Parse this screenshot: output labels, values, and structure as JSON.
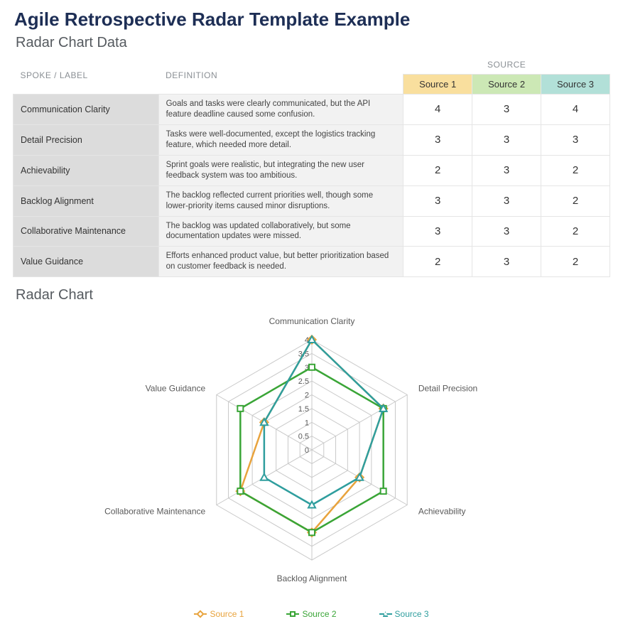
{
  "page_title": "Agile Retrospective Radar Template Example",
  "table_heading": "Radar Chart Data",
  "chart_heading": "Radar Chart",
  "headers": {
    "spoke": "SPOKE / LABEL",
    "definition": "DEFINITION",
    "source_group": "SOURCE",
    "sources": [
      "Source 1",
      "Source 2",
      "Source 3"
    ]
  },
  "rows": [
    {
      "spoke": "Communication Clarity",
      "definition": "Goals and tasks were clearly communicated, but the API feature deadline caused some confusion.",
      "values": [
        4,
        3,
        4
      ]
    },
    {
      "spoke": "Detail Precision",
      "definition": "Tasks were well-documented, except the logistics tracking feature, which needed more detail.",
      "values": [
        3,
        3,
        3
      ]
    },
    {
      "spoke": "Achievability",
      "definition": "Sprint goals were realistic, but integrating the new user feedback system was too ambitious.",
      "values": [
        2,
        3,
        2
      ]
    },
    {
      "spoke": "Backlog Alignment",
      "definition": "The backlog reflected current priorities well, though some lower-priority items caused minor disruptions.",
      "values": [
        3,
        3,
        2
      ]
    },
    {
      "spoke": "Collaborative Maintenance",
      "definition": "The backlog was updated collaboratively, but some documentation updates were missed.",
      "values": [
        3,
        3,
        2
      ]
    },
    {
      "spoke": "Value Guidance",
      "definition": "Efforts enhanced product value, but better prioritization based on customer feedback is needed.",
      "values": [
        2,
        3,
        2
      ]
    }
  ],
  "legend": [
    "Source 1",
    "Source 2",
    "Source 3"
  ],
  "series_colors": {
    "Source 1": "#e8a33d",
    "Source 2": "#3aa537",
    "Source 3": "#2f9e9e"
  },
  "chart_data": {
    "type": "radar",
    "title": "",
    "categories": [
      "Communication Clarity",
      "Detail Precision",
      "Achievability",
      "Backlog Alignment",
      "Collaborative Maintenance",
      "Value Guidance"
    ],
    "series": [
      {
        "name": "Source 1",
        "values": [
          4,
          3,
          2,
          3,
          3,
          2
        ]
      },
      {
        "name": "Source 2",
        "values": [
          3,
          3,
          3,
          3,
          3,
          3
        ]
      },
      {
        "name": "Source 3",
        "values": [
          4,
          3,
          2,
          2,
          2,
          2
        ]
      }
    ],
    "ticks": [
      0,
      0.5,
      1,
      1.5,
      2,
      2.5,
      3,
      3.5,
      4
    ],
    "rlim": [
      0,
      4
    ]
  }
}
